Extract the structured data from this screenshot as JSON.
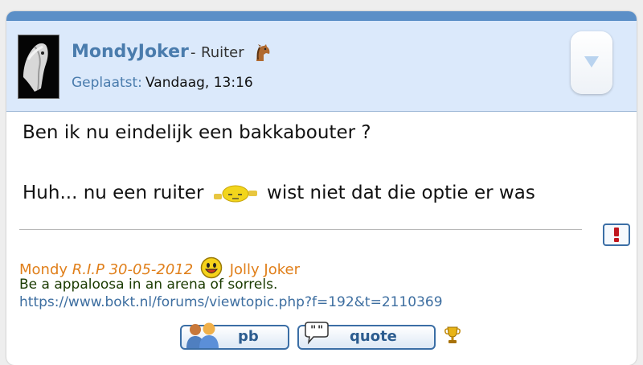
{
  "post": {
    "author": "MondyJoker",
    "separator": "-",
    "rank": "Ruiter",
    "posted_label": "Geplaatst:",
    "posted_value": "Vandaag, 13:16",
    "body_line1": "Ben ik nu eindelijk een bakkabouter ?",
    "body_line2_before": "Huh... nu een ruiter",
    "body_line2_after": "wist niet dat die optie er was"
  },
  "signature": {
    "name": "Mondy",
    "rip": "R.I.P 30-05-2012",
    "after_smiley": "Jolly Joker",
    "quote": "Be a appaloosa in an arena of sorrels.",
    "link": "https://www.bokt.nl/forums/viewtopic.php?f=192&t=2110369"
  },
  "buttons": {
    "pb_label": "pb",
    "quote_label": "quote"
  },
  "icons": {
    "rank": "horse-icon",
    "collapse": "chevron-down-icon",
    "report": "exclamation-icon",
    "inline_smiley": "sleeping-smiley-icon",
    "signature_smiley": "grin-smiley-icon",
    "pb": "users-icon",
    "quote": "speech-bubble-icon",
    "award": "trophy-icon"
  },
  "colors": {
    "accent": "#5b8fc7",
    "header_bg": "#dbe9fb",
    "username": "#4a7cad",
    "signature_name": "#e07f1a",
    "link": "#3d6ea0"
  }
}
